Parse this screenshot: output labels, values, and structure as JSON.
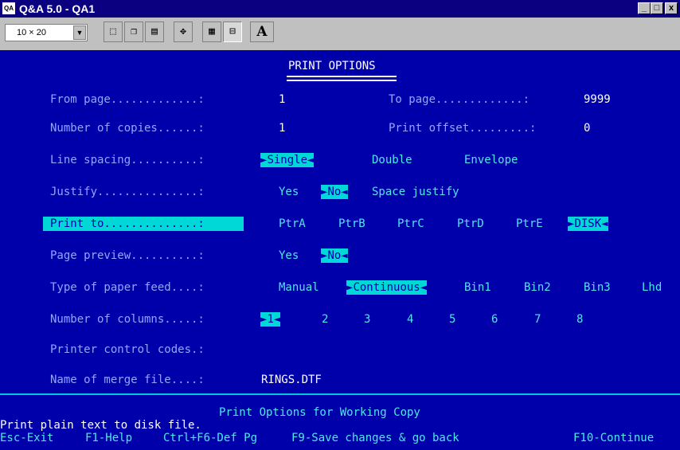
{
  "window": {
    "title": "Q&A 5.0 - QA1",
    "icon_text": "QA",
    "min_glyph": "_",
    "max_glyph": "□",
    "close_glyph": "x"
  },
  "toolbar": {
    "font_size": "10 × 20",
    "buttons": [
      "mark-icon",
      "copy-icon",
      "paste-icon",
      "fullscreen-icon",
      "properties-icon",
      "background-icon",
      "font-icon"
    ],
    "font_button_label": "A"
  },
  "screen": {
    "title": "PRINT OPTIONS",
    "fields": {
      "from_page": {
        "label": "From page.............:",
        "value": "1"
      },
      "to_page": {
        "label": "To page.............:",
        "value": "9999"
      },
      "copies": {
        "label": "Number of copies......:",
        "value": "1"
      },
      "offset": {
        "label": "Print offset.........:",
        "value": "0"
      },
      "line_spacing": {
        "label": "Line spacing..........:",
        "options": [
          "Single",
          "Double",
          "Envelope"
        ],
        "selected": "Single"
      },
      "justify": {
        "label": "Justify...............:",
        "options": [
          "Yes",
          "No",
          "Space justify"
        ],
        "selected": "No"
      },
      "print_to": {
        "label": "Print to..............:",
        "options": [
          "PtrA",
          "PtrB",
          "PtrC",
          "PtrD",
          "PtrE",
          "DISK"
        ],
        "selected": "DISK"
      },
      "page_preview": {
        "label": "Page preview..........:",
        "options": [
          "Yes",
          "No"
        ],
        "selected": "No"
      },
      "paper_feed": {
        "label": "Type of paper feed....:",
        "options": [
          "Manual",
          "Continuous",
          "Bin1",
          "Bin2",
          "Bin3",
          "Lhd"
        ],
        "selected": "Continuous"
      },
      "columns": {
        "label": "Number of columns.....:",
        "options": [
          "1",
          "2",
          "3",
          "4",
          "5",
          "6",
          "7",
          "8"
        ],
        "selected": "1"
      },
      "control_codes": {
        "label": "Printer control codes.:",
        "value": ""
      },
      "merge_file": {
        "label": "Name of merge file....:",
        "value": "RINGS.DTF"
      }
    },
    "footer_title": "Print Options for Working Copy",
    "message": "Print plain text to disk file.",
    "keys": [
      "Esc-Exit",
      "F1-Help",
      "Ctrl+F6-Def Pg",
      "F9-Save changes & go back",
      "F10-Continue"
    ],
    "selector_left": "►",
    "selector_right": "◄"
  }
}
